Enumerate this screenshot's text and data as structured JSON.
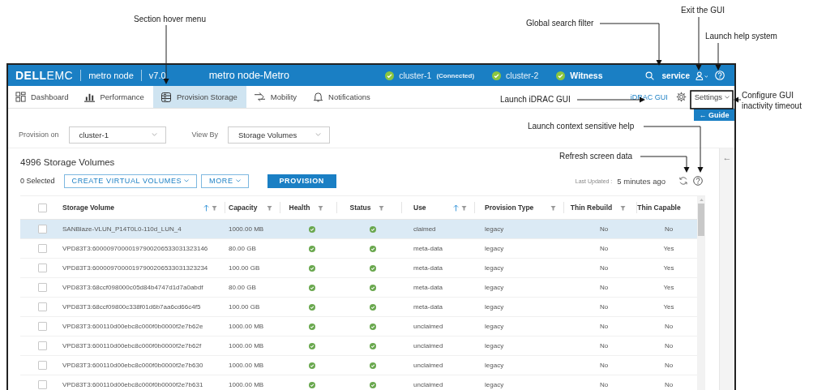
{
  "annotations": [
    {
      "text": "Section hover menu"
    },
    {
      "text": "Global search filter"
    },
    {
      "text": "Exit the GUI"
    },
    {
      "text": "Launch help system"
    },
    {
      "text": "Launch iDRAC GUI"
    },
    {
      "text": "Configure GUI inactivity timeout"
    },
    {
      "text": "Launch context sensitive help"
    },
    {
      "text": "Refresh screen data"
    }
  ],
  "header": {
    "logo": {
      "dell": "DELL",
      "emc": "EMC"
    },
    "product": "metro node",
    "version": "v7.0",
    "system": "metro node-Metro",
    "clusters": [
      {
        "name": "cluster-1",
        "note": "(Connected)",
        "ok": true,
        "bold": false
      },
      {
        "name": "cluster-2",
        "ok": true,
        "bold": false
      },
      {
        "name": "Witness",
        "ok": true,
        "bold": true
      }
    ],
    "user": "service"
  },
  "nav": {
    "tabs": [
      {
        "label": "Dashboard",
        "selected": false
      },
      {
        "label": "Performance",
        "selected": false
      },
      {
        "label": "Provision Storage",
        "selected": true
      },
      {
        "label": "Mobility",
        "selected": false
      },
      {
        "label": "Notifications",
        "selected": false
      }
    ],
    "idrac_link": "iDRAC GUI",
    "settings": "Settings"
  },
  "guide_button": "← Guide",
  "filters": [
    {
      "label": "Provision on",
      "value": "cluster-1"
    },
    {
      "label": "View By",
      "value": "Storage Volumes"
    }
  ],
  "title": "4996 Storage Volumes",
  "selected_count": "0 Selected",
  "actions": [
    {
      "label": "CREATE VIRTUAL VOLUMES",
      "kind": "outline",
      "dropdown": true
    },
    {
      "label": "MORE",
      "kind": "outline",
      "dropdown": true
    },
    {
      "label": "PROVISION",
      "kind": "primary",
      "dropdown": false
    }
  ],
  "last_updated_label": "Last Updated :",
  "last_updated": "5 minutes ago",
  "side_panel": {
    "arrow": "←"
  },
  "table": {
    "select_all": {
      "checked": false
    },
    "columns": [
      {
        "label": "Storage Volume",
        "sorted_ascending": true,
        "filter": true
      },
      {
        "label": "Capacity",
        "sorted_ascending": false,
        "filter": true
      },
      {
        "label": "Health",
        "sorted_ascending": false,
        "filter": true
      },
      {
        "label": "Status",
        "sorted_ascending": false,
        "filter": true
      },
      {
        "label": "Use",
        "sorted_ascending": true,
        "filter": true
      },
      {
        "label": "Provision Type",
        "sorted_ascending": false,
        "filter": true
      },
      {
        "label": "Thin Rebuild",
        "sorted_ascending": false,
        "filter": true
      },
      {
        "label": "Thin Capable",
        "sorted_ascending": false,
        "filter": false
      }
    ],
    "rows": [
      {
        "checked": false,
        "hovered": true,
        "volume": "SANBlaze-VLUN_P14T0L0-110d_LUN_4",
        "capacity": "1000.00 MB",
        "health_ok": true,
        "status_ok": true,
        "use": "claimed",
        "provision_type": "legacy",
        "thin_rebuild": "No",
        "thin_capable": "No"
      },
      {
        "checked": false,
        "hovered": false,
        "volume": "VPD83T3:60000970000197900206533031323146",
        "capacity": "80.00 GB",
        "health_ok": true,
        "status_ok": true,
        "use": "meta-data",
        "provision_type": "legacy",
        "thin_rebuild": "No",
        "thin_capable": "Yes"
      },
      {
        "checked": false,
        "hovered": false,
        "volume": "VPD83T3:60000970000197900206533031323234",
        "capacity": "100.00 GB",
        "health_ok": true,
        "status_ok": true,
        "use": "meta-data",
        "provision_type": "legacy",
        "thin_rebuild": "No",
        "thin_capable": "Yes"
      },
      {
        "checked": false,
        "hovered": false,
        "volume": "VPD83T3:68ccf098000c05d84b4747d1d7a0abdf",
        "capacity": "80.00 GB",
        "health_ok": true,
        "status_ok": true,
        "use": "meta-data",
        "provision_type": "legacy",
        "thin_rebuild": "No",
        "thin_capable": "Yes"
      },
      {
        "checked": false,
        "hovered": false,
        "volume": "VPD83T3:68ccf09800c338f01d6b7aa6cd66c4f5",
        "capacity": "100.00 GB",
        "health_ok": true,
        "status_ok": true,
        "use": "meta-data",
        "provision_type": "legacy",
        "thin_rebuild": "No",
        "thin_capable": "Yes"
      },
      {
        "checked": false,
        "hovered": false,
        "volume": "VPD83T3:600110d00ebc8c000f0b0000f2e7b62e",
        "capacity": "1000.00 MB",
        "health_ok": true,
        "status_ok": true,
        "use": "unclaimed",
        "provision_type": "legacy",
        "thin_rebuild": "No",
        "thin_capable": "No"
      },
      {
        "checked": false,
        "hovered": false,
        "volume": "VPD83T3:600110d00ebc8c000f0b0000f2e7b62f",
        "capacity": "1000.00 MB",
        "health_ok": true,
        "status_ok": true,
        "use": "unclaimed",
        "provision_type": "legacy",
        "thin_rebuild": "No",
        "thin_capable": "No"
      },
      {
        "checked": false,
        "hovered": false,
        "volume": "VPD83T3:600110d00ebc8c000f0b0000f2e7b630",
        "capacity": "1000.00 MB",
        "health_ok": true,
        "status_ok": true,
        "use": "unclaimed",
        "provision_type": "legacy",
        "thin_rebuild": "No",
        "thin_capable": "No"
      },
      {
        "checked": false,
        "hovered": false,
        "volume": "VPD83T3:600110d00ebc8c000f0b0000f2e7b631",
        "capacity": "1000.00 MB",
        "health_ok": true,
        "status_ok": true,
        "use": "unclaimed",
        "provision_type": "legacy",
        "thin_rebuild": "No",
        "thin_capable": "No"
      }
    ]
  }
}
